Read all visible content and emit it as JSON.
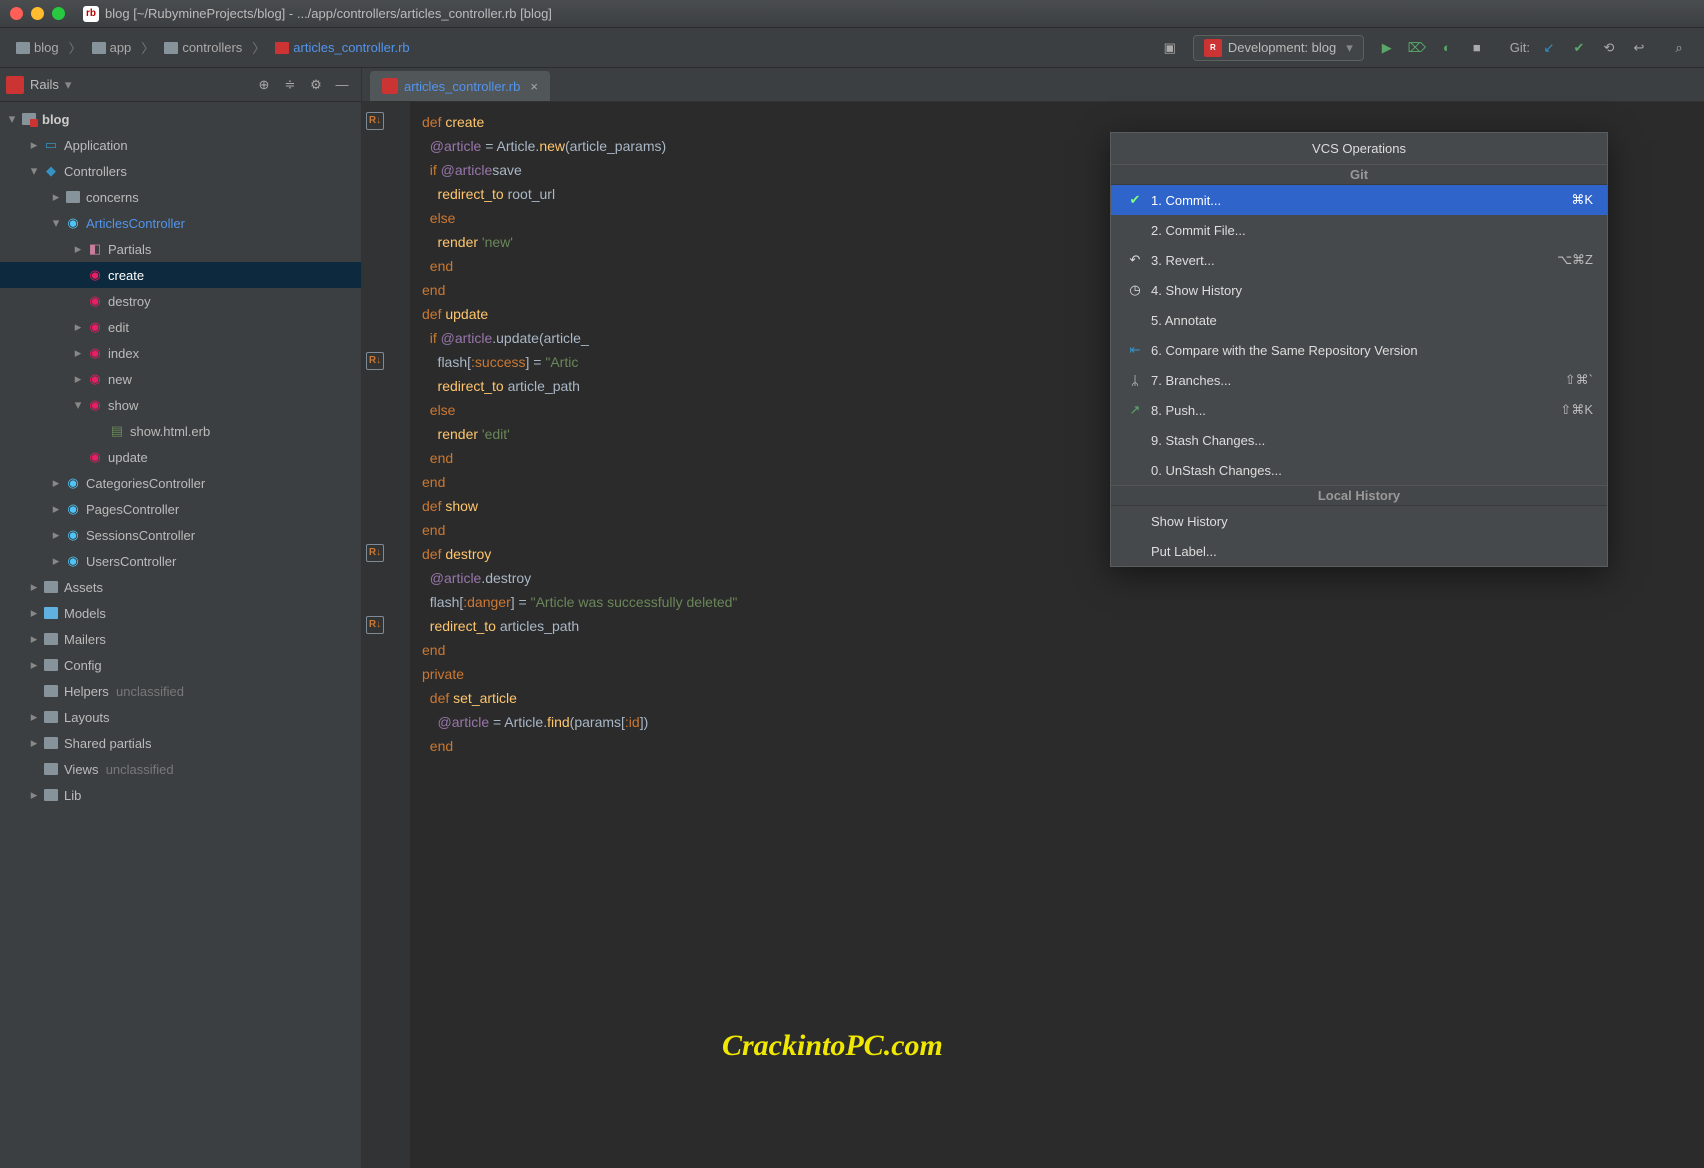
{
  "title": "blog [~/RubymineProjects/blog] - .../app/controllers/articles_controller.rb [blog]",
  "breadcrumbs": [
    "blog",
    "app",
    "controllers",
    "articles_controller.rb"
  ],
  "run_config": {
    "label": "Development: blog"
  },
  "git_label": "Git:",
  "rails_panel": "Rails",
  "tree": {
    "root": "blog",
    "n_app": "Application",
    "n_ctrl": "Controllers",
    "n_concerns": "concerns",
    "n_art": "ArticlesController",
    "n_partials": "Partials",
    "n_create": "create",
    "n_destroy": "destroy",
    "n_edit": "edit",
    "n_index": "index",
    "n_new": "new",
    "n_show": "show",
    "n_showerb": "show.html.erb",
    "n_update": "update",
    "n_cat": "CategoriesController",
    "n_pages": "PagesController",
    "n_sess": "SessionsController",
    "n_users": "UsersController",
    "n_assets": "Assets",
    "n_models": "Models",
    "n_mailers": "Mailers",
    "n_config": "Config",
    "n_helpers": "Helpers",
    "n_helpers_m": "unclassified",
    "n_layouts": "Layouts",
    "n_sp": "Shared partials",
    "n_views": "Views",
    "n_views_m": "unclassified",
    "n_lib": "Lib"
  },
  "tab": "articles_controller.rb",
  "code": {
    "l1a": "def ",
    "l1b": "create",
    "l2a": "  @article",
    "l2b": " = Article.",
    "l2c": "new",
    "l2d": "(article_params)",
    "l3": "",
    "l4a": "  if ",
    "l4b": "@article",
    ".": ".",
    "l4c": "save",
    "l5a": "    redirect_to ",
    "l5b": "root_url",
    "l6": "  else",
    "l7a": "    render ",
    "l7b": "'new'",
    "l8": "  end",
    "l9": "end",
    "l10": "",
    "l11a": "def ",
    "l11b": "update",
    "l12a": "  if ",
    "l12b": "@article",
    "l12c": ".update(article_",
    "l13a": "    flash[",
    "l13b": ":success",
    "l13c": "] = ",
    "l13d": "\"Artic",
    "l14a": "    redirect_to ",
    "l14b": "article_path",
    "l15": "  else",
    "l16a": "    render ",
    "l16b": "'edit'",
    "l17": "  end",
    "l18": "end",
    "l19": "",
    "l20a": "def ",
    "l20b": "show",
    "l21": "end",
    "l22": "",
    "l23a": "def ",
    "l23b": "destroy",
    "l24a": "  @article",
    "l24b": ".destroy",
    "l25a": "  flash[",
    "l25b": ":danger",
    "l25c": "] = ",
    "l25d": "\"Article was successfully deleted\"",
    "l26a": "  redirect_to ",
    "l26b": "articles_path",
    "l27": "end",
    "l28": "",
    "l29": "private",
    "l30a": "  def ",
    "l30b": "set_article",
    "l31a": "    @article",
    "l31b": " = Article.",
    "l31c": "find",
    "l31d": "(params[",
    "l31e": ":id",
    "l31f": "])",
    "l32": "  end"
  },
  "watermark": "CrackintoPC.com",
  "popup": {
    "title": "VCS Operations",
    "sec_git": "Git",
    "sec_lh": "Local History",
    "i1": "1. Commit...",
    "k1": "⌘K",
    "i2": "2. Commit File...",
    "i3": "3. Revert...",
    "k3": "⌥⌘Z",
    "i4": "4. Show History",
    "i5": "5. Annotate",
    "i6": "6. Compare with the Same Repository Version",
    "i7": "7. Branches...",
    "k7": "⇧⌘`",
    "i8": "8. Push...",
    "k8": "⇧⌘K",
    "i9": "9. Stash Changes...",
    "i0": "0. UnStash Changes...",
    "lh1": "Show History",
    "lh2": "Put Label..."
  }
}
